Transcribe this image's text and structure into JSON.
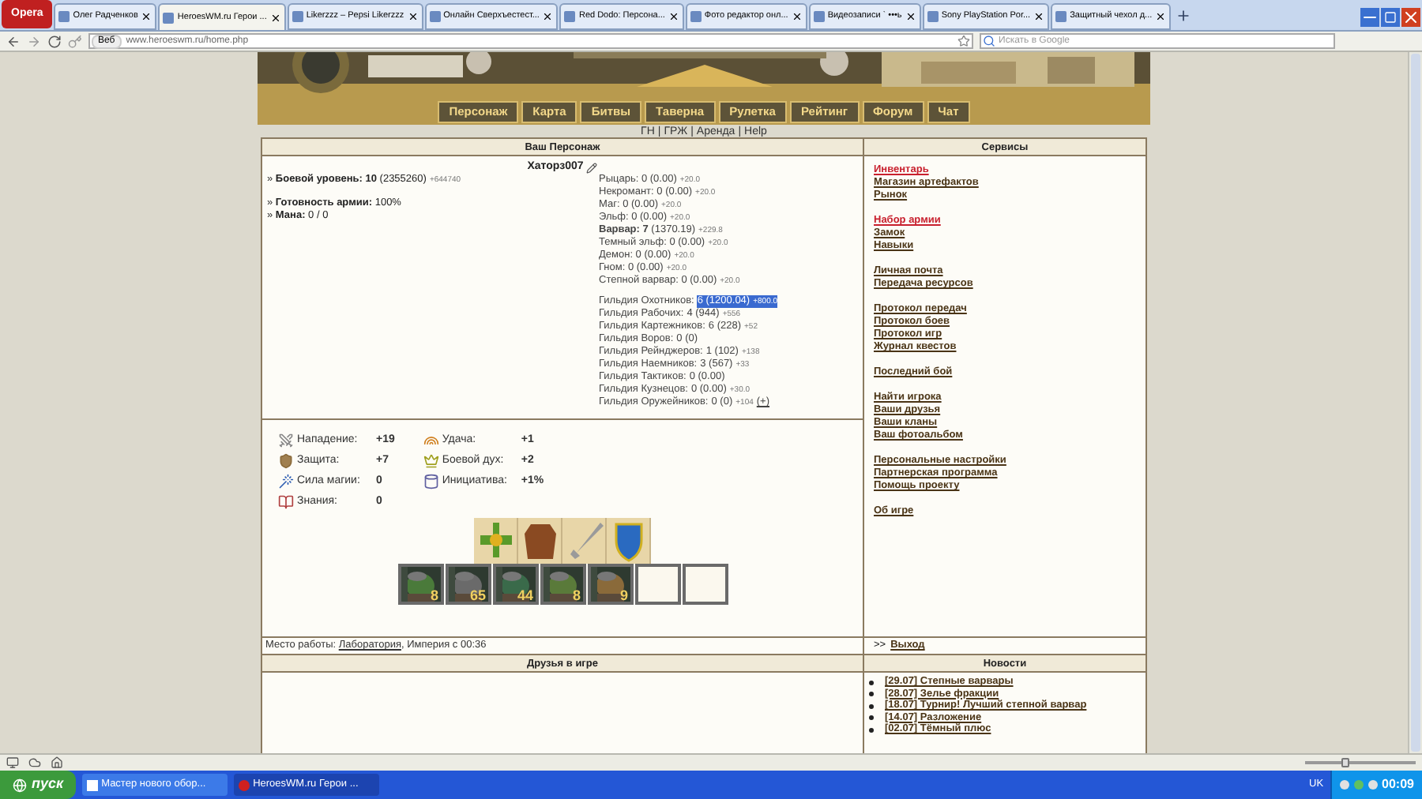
{
  "browser": {
    "opera_button": "Opera",
    "tabs": [
      {
        "title": "Олег Радченков",
        "selected": false
      },
      {
        "title": "HeroesWM.ru Герои ...",
        "selected": true
      },
      {
        "title": "Likerzzz – Pepsi Likerzzz",
        "selected": false
      },
      {
        "title": "Онлайн Сверхъестест...",
        "selected": false
      },
      {
        "title": "Red Dodo: Персона...",
        "selected": false
      },
      {
        "title": "Фото редактор онл...",
        "selected": false
      },
      {
        "title": "Видеозаписи ` •••ь",
        "selected": false
      },
      {
        "title": "Sony PlayStation Por...",
        "selected": false
      },
      {
        "title": "Защитный чехол д...",
        "selected": false
      }
    ],
    "web_badge": "Веб",
    "address": "www.heroeswm.ru/home.php",
    "search": {
      "placeholder": "Искать в Google"
    }
  },
  "site": {
    "nav": [
      "Персонаж",
      "Карта",
      "Битвы",
      "Таверна",
      "Рулетка",
      "Рейтинг",
      "Форум",
      "Чат"
    ],
    "sublinks": [
      "ГН",
      "ГРЖ",
      "Аренда",
      "Help"
    ],
    "separator": "|"
  },
  "character": {
    "title": "Ваш Персонаж",
    "name": "Хаторз007",
    "info_groups": [
      [
        {
          "text": "» **Боевой уровень: 10** (2355260)",
          "delta": "+644740"
        }
      ],
      [
        {
          "text": "» **Готовность армии:** 100%"
        },
        {
          "text": "» **Мана:** 0 / 0"
        }
      ]
    ],
    "factions": [
      {
        "text": "Рыцарь: 0 (0.00)",
        "delta": "+20.0"
      },
      {
        "text": "Некромант: 0 (0.00)",
        "delta": "+20.0"
      },
      {
        "text": "Маг: 0 (0.00)",
        "delta": "+20.0"
      },
      {
        "text": "Эльф: 0 (0.00)",
        "delta": "+20.0"
      },
      {
        "text": "**Варвар: 7** (1370.19)",
        "delta": "+229.8"
      },
      {
        "text": "Темный эльф: 0 (0.00)",
        "delta": "+20.0"
      },
      {
        "text": "Демон: 0 (0.00)",
        "delta": "+20.0"
      },
      {
        "text": "Гном: 0 (0.00)",
        "delta": "+20.0"
      },
      {
        "text": "Степной варвар: 0 (0.00)",
        "delta": "+20.0"
      }
    ],
    "guilds": [
      {
        "label": "Гильдия Охотников:",
        "value": "6 (1200.04)",
        "delta": "+800.0",
        "selected": true
      },
      {
        "label": "Гильдия Рабочих:",
        "value": "4 (944)",
        "delta": "+556",
        "selected": false
      },
      {
        "label": "Гильдия Картежников:",
        "value": "6 (228)",
        "delta": "+52",
        "selected": false
      },
      {
        "label": "Гильдия Воров:",
        "value": "0 (0)",
        "selected": false
      },
      {
        "label": "Гильдия Рейнджеров:",
        "value": "1 (102)",
        "delta": "+138",
        "selected": false
      },
      {
        "label": "Гильдия Наемников:",
        "value": "3 (567)",
        "delta": "+33",
        "selected": false
      },
      {
        "label": "Гильдия Тактиков:",
        "value": "0 (0.00)",
        "selected": false
      },
      {
        "label": "Гильдия Кузнецов:",
        "value": "0 (0.00)",
        "delta": "+30.0",
        "selected": false
      },
      {
        "label": "Гильдия Оружейников:",
        "value": "0 (0)",
        "delta": "+104",
        "link": "(+)",
        "selected": false
      }
    ],
    "stat_columns": [
      [
        {
          "kind": "attack",
          "label": "Нападение:",
          "value": "+19"
        },
        {
          "kind": "defense",
          "label": "Защита:",
          "value": "+7"
        },
        {
          "kind": "spellpower",
          "label": "Сила магии:",
          "value": "0"
        },
        {
          "kind": "knowledge",
          "label": "Знания:",
          "value": "0"
        }
      ],
      [
        {
          "kind": "luck",
          "label": "Удача:",
          "value": "+1"
        },
        {
          "kind": "morale",
          "label": "Боевой дух:",
          "value": "+2"
        },
        {
          "kind": "initiative",
          "label": "Инициатива:",
          "value": "+1%"
        }
      ]
    ],
    "artifacts": [
      {
        "kind": "amulet"
      },
      {
        "kind": "armor"
      },
      {
        "kind": "sword"
      },
      {
        "kind": "shield"
      }
    ],
    "army": [
      {
        "kind": "unit",
        "count": "8"
      },
      {
        "kind": "unit",
        "count": "65"
      },
      {
        "kind": "unit",
        "count": "44"
      },
      {
        "kind": "unit",
        "count": "8"
      },
      {
        "kind": "unit",
        "count": "9"
      },
      {
        "kind": "empty"
      },
      {
        "kind": "empty"
      }
    ],
    "workplace": {
      "label": "Место работы:",
      "link": "Лаборатория",
      "rest": ", Империя с 00:36"
    }
  },
  "services": {
    "title": "Сервисы",
    "groups": [
      [
        {
          "label": "Инвентарь",
          "highlighted": true
        },
        {
          "label": "Магазин артефактов",
          "highlighted": false
        },
        {
          "label": "Рынок",
          "highlighted": false
        }
      ],
      [
        {
          "label": "Набор армии",
          "highlighted": true
        },
        {
          "label": "Замок",
          "highlighted": false
        },
        {
          "label": "Навыки",
          "highlighted": false
        }
      ],
      [
        {
          "label": "Личная почта",
          "highlighted": false
        },
        {
          "label": "Передача ресурсов",
          "highlighted": false
        }
      ],
      [
        {
          "label": "Протокол передач",
          "highlighted": false
        },
        {
          "label": "Протокол боев",
          "highlighted": false
        },
        {
          "label": "Протокол игр",
          "highlighted": false
        },
        {
          "label": "Журнал квестов",
          "highlighted": false
        }
      ],
      [
        {
          "label": "Последний бой",
          "highlighted": false
        }
      ],
      [
        {
          "label": "Найти игрока",
          "highlighted": false
        },
        {
          "label": "Ваши друзья",
          "highlighted": false
        },
        {
          "label": "Ваши кланы",
          "highlighted": false
        },
        {
          "label": "Ваш фотоальбом",
          "highlighted": false
        }
      ],
      [
        {
          "label": "Персональные настройки",
          "highlighted": false
        },
        {
          "label": "Партнерская программа",
          "highlighted": false
        },
        {
          "label": "Помощь проекту",
          "highlighted": false
        }
      ],
      [
        {
          "label": "Об игре",
          "highlighted": false
        }
      ]
    ],
    "exit_prefix": ">>",
    "exit_link": "Выход"
  },
  "friends": {
    "title": "Друзья в игре"
  },
  "news": {
    "title": "Новости",
    "items": [
      "[29.07] Степные варвары",
      "[28.07] Зелье фракции",
      "[18.07] Турнир! Лучший степной варвар",
      "[14.07] Разложение",
      "[02.07] Тёмный плюс"
    ]
  },
  "status_bar": {
    "zoom": {
      "level": 0.35
    }
  },
  "taskbar": {
    "start": "пуск",
    "tasks": [
      {
        "title": "Мастер нового обор...",
        "selected": false
      },
      {
        "title": "HeroesWM.ru Герои ...",
        "selected": true
      }
    ],
    "language": "UK",
    "clock": "00:09"
  }
}
